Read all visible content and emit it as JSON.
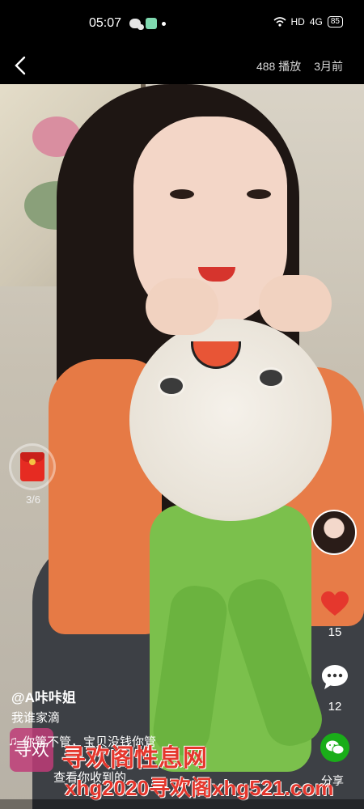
{
  "status_bar": {
    "time": "05:07",
    "network": "HD",
    "signal": "4G",
    "battery": "85"
  },
  "header": {
    "plays": "488 播放",
    "age": "3月前"
  },
  "red_packet": {
    "progress": "3/6"
  },
  "actions": {
    "likes": "15",
    "comments": "12",
    "share_label": "分享"
  },
  "post": {
    "author": "@A咔咔姐",
    "description": "我谁家滴",
    "music": "你管不管，宝贝没钱你管",
    "view_income": "查看你收到的"
  },
  "watermark": {
    "logo": "寻欢",
    "title": "寻欢阁性息网",
    "url": "xhg2020寻欢阁xhg521.com"
  },
  "colors": {
    "like": "#e5372d",
    "wechat": "#1aad19",
    "red_packet": "#e62b22"
  }
}
